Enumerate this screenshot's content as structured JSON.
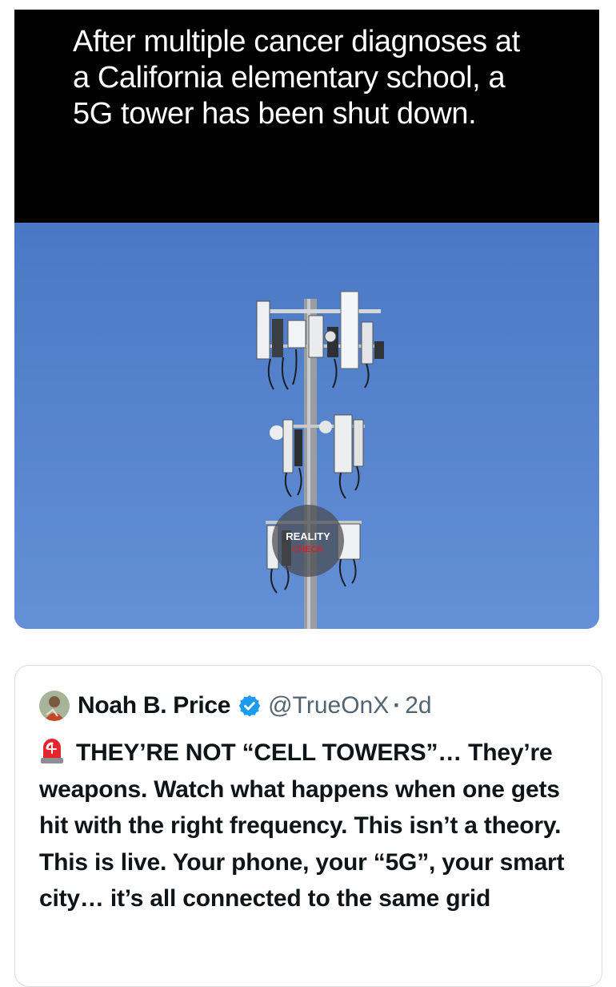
{
  "headline": "After multiple cancer diagnoses at a California elementary school, a 5G tower has been shut down.",
  "watermark": {
    "line1": "REALITY",
    "line2": "CHECK"
  },
  "quoted_post": {
    "author_name": "Noah B. Price",
    "handle": "@TrueOnX",
    "separator": "·",
    "age": "2d",
    "verified_icon": "verified-badge-icon",
    "alert_icon": "rotating-light-emoji",
    "body": "THEY’RE NOT “CELL TOWERS”… They’re weapons. Watch what happens when one gets hit with the right frequency. This isn’t a theory. This is live. Your phone, your “5G”, your smart city… it’s all connected to the same grid"
  },
  "colors": {
    "sky": "#5583cf",
    "verified": "#1d9bf0",
    "handle_gray": "#536471"
  }
}
